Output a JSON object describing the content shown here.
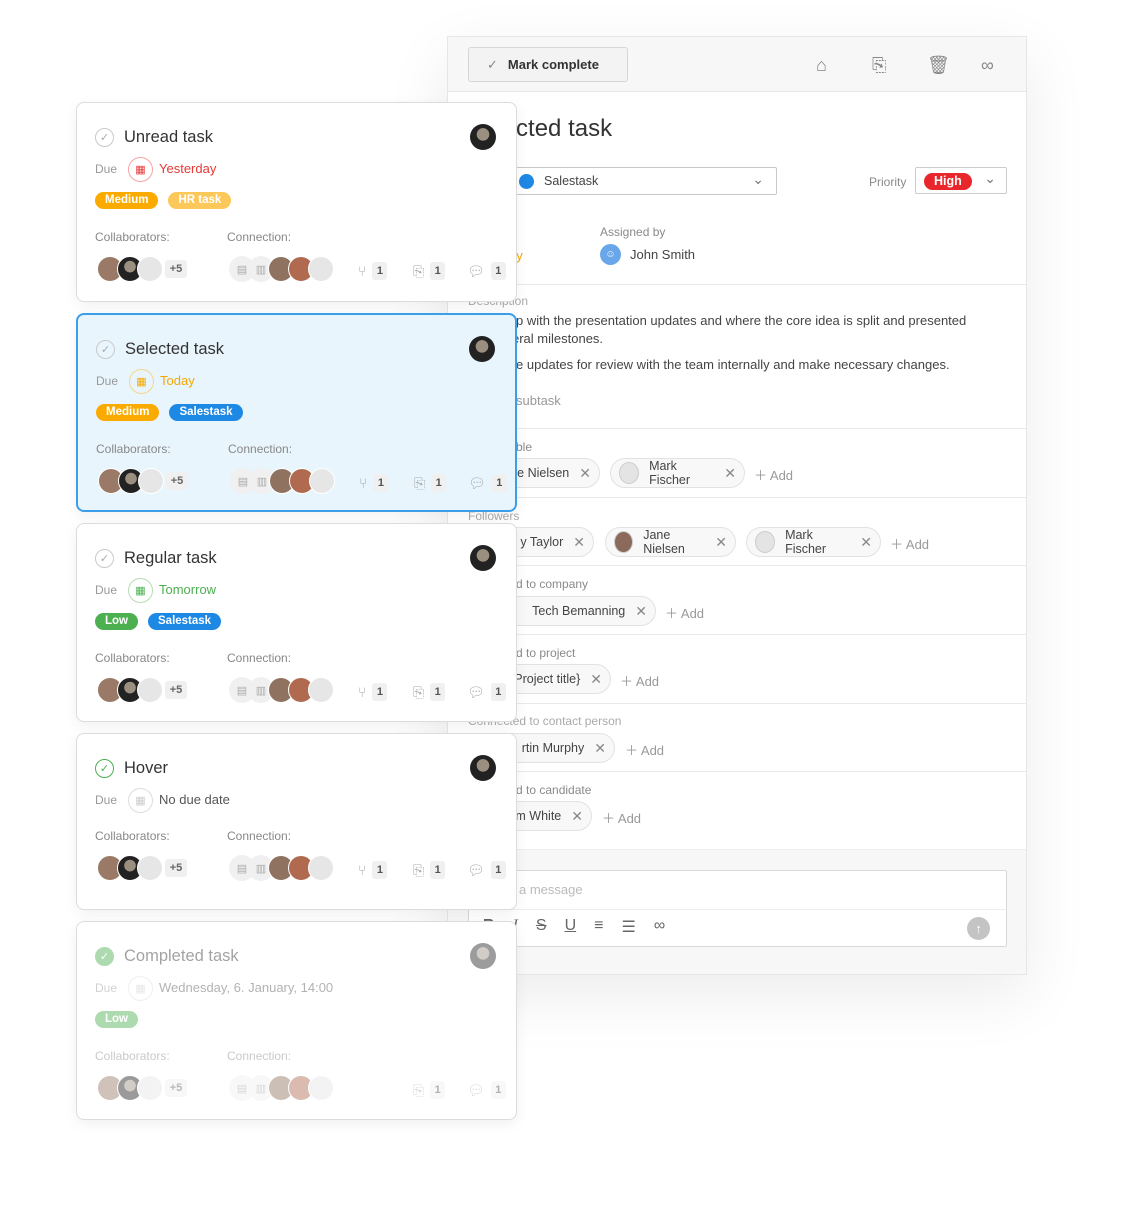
{
  "detail": {
    "mark_complete": "Mark complete",
    "toolbar_icons": [
      "tag-icon",
      "paperclip-icon",
      "trash-icon",
      "link-icon"
    ],
    "title": "Selected task",
    "type_value": "Salestask",
    "type_color": "#1e88e5",
    "priority_label": "Priority",
    "priority_value": "High",
    "priority_color": "#e8262b",
    "due_value": "Today",
    "assigned_by_label": "Assigned by",
    "assigned_by_name": "John Smith",
    "description_label": "Description",
    "description_lines": [
      "p with the presentation updates and where the core idea is split and presented",
      "eral milestones.",
      "e updates for review with the team internally and make necessary changes."
    ],
    "add_subtask": "subtask",
    "responsible_label": "ble",
    "responsible": [
      "e Nielsen",
      "Mark Fischer"
    ],
    "followers_label": "Followers",
    "followers": [
      "y Taylor",
      "Jane Nielsen",
      "Mark Fischer"
    ],
    "company_label": "d to company",
    "company": "Tech Bemanning",
    "project_label": "d to project",
    "project": "Project title}",
    "contact_label": "Connected to contact person",
    "contact": "rtin Murphy",
    "candidate_label": "d to candidate",
    "candidate": "m White",
    "add_label": "Add",
    "message_placeholder": "a message",
    "editor_icons": [
      "bold-icon",
      "italic-icon",
      "strikethrough-icon",
      "underline-icon",
      "ordered-list-icon",
      "bullet-list-icon",
      "link-icon",
      "send-icon"
    ]
  },
  "cards": [
    {
      "title": "Unread task",
      "state": "unread",
      "due_label": "Due",
      "due": "Yesterday",
      "due_color": "#e53935",
      "tags": [
        {
          "label": "Medium",
          "color": "#fbab00"
        },
        {
          "label": "HR task",
          "color": "#fcc85a"
        }
      ],
      "collab_label": "Collaborators:",
      "conn_label": "Connection:",
      "more": "+5",
      "subtasks": "1",
      "attachments": "1",
      "comments": "1"
    },
    {
      "title": "Selected task",
      "state": "selected",
      "due_label": "Due",
      "due": "Today",
      "due_color": "#f5a800",
      "tags": [
        {
          "label": "Medium",
          "color": "#fbab00"
        },
        {
          "label": "Salestask",
          "color": "#1e88e5"
        }
      ],
      "collab_label": "Collaborators:",
      "conn_label": "Connection:",
      "more": "+5",
      "subtasks": "1",
      "attachments": "1",
      "comments": "1"
    },
    {
      "title": "Regular task",
      "state": "regular",
      "due_label": "Due",
      "due": "Tomorrow",
      "due_color": "#4caf50",
      "tags": [
        {
          "label": "Low",
          "color": "#4caf50"
        },
        {
          "label": "Salestask",
          "color": "#1e88e5"
        }
      ],
      "collab_label": "Collaborators:",
      "conn_label": "Connection:",
      "more": "+5",
      "subtasks": "1",
      "attachments": "1",
      "comments": "1"
    },
    {
      "title": "Hover",
      "state": "hover",
      "due_label": "Due",
      "due": "No due date",
      "due_color": "#555555",
      "tags": [],
      "collab_label": "Collaborators:",
      "conn_label": "Connection:",
      "more": "+5",
      "subtasks": "1",
      "attachments": "1",
      "comments": "1"
    },
    {
      "title": "Completed task",
      "state": "completed",
      "due_label": "Due",
      "due": "Wednesday, 6. January, 14:00",
      "due_color": "#555555",
      "tags": [
        {
          "label": "Low",
          "color": "#4caf50"
        }
      ],
      "collab_label": "Collaborators:",
      "conn_label": "Connection:",
      "more": "+5",
      "attachments": "1",
      "comments": "1"
    }
  ]
}
